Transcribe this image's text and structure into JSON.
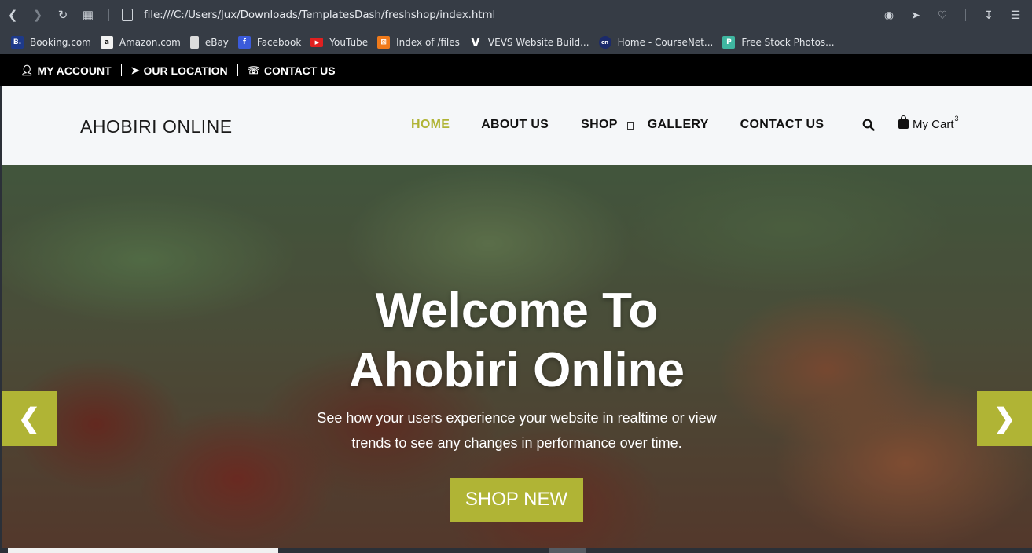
{
  "browser": {
    "url": "file:///C:/Users/Jux/Downloads/TemplatesDash/freshshop/index.html",
    "bookmarks": [
      {
        "label": "Booking.com",
        "icon": "booking-icon",
        "color": "#1e3a8a",
        "glyph": "B."
      },
      {
        "label": "Amazon.com",
        "icon": "amazon-icon",
        "color": "#f2f2f2",
        "glyph": "a"
      },
      {
        "label": "eBay",
        "icon": "page-icon",
        "color": "#dcdcdc",
        "glyph": ""
      },
      {
        "label": "Facebook",
        "icon": "facebook-icon",
        "color": "#3b5bdb",
        "glyph": "f"
      },
      {
        "label": "YouTube",
        "icon": "youtube-icon",
        "color": "#e02020",
        "glyph": "▶"
      },
      {
        "label": "Index of /files",
        "icon": "xampp-icon",
        "color": "#f07a1a",
        "glyph": "⊠"
      },
      {
        "label": "VEVS Website Build...",
        "icon": "vevs-icon",
        "color": "#363c45",
        "glyph": "V"
      },
      {
        "label": "Home - CourseNet...",
        "icon": "coursenet-icon",
        "color": "#1b2a6b",
        "glyph": "cn"
      },
      {
        "label": "Free Stock Photos...",
        "icon": "stock-photos-icon",
        "color": "#3fb6a0",
        "glyph": "P"
      }
    ]
  },
  "topbar": {
    "my_account": "MY ACCOUNT",
    "our_location": "OUR LOCATION",
    "contact_us": "CONTACT US"
  },
  "header": {
    "logo": "AHOBIRI ONLINE",
    "menu": {
      "home": "HOME",
      "about": "ABOUT US",
      "shop": "SHOP",
      "gallery": "GALLERY",
      "contact": "CONTACT US"
    },
    "cart_label": "My Cart",
    "cart_count": "3"
  },
  "hero": {
    "title_line1": "Welcome To",
    "title_line2": "Ahobiri Online",
    "subtitle_line1": "See how your users experience your website in realtime or view",
    "subtitle_line2": "trends to see any changes in performance over time.",
    "button": "SHOP NEW"
  },
  "colors": {
    "accent": "#b0b435",
    "topbar_bg": "#000000",
    "header_bg": "#f5f7f9"
  }
}
